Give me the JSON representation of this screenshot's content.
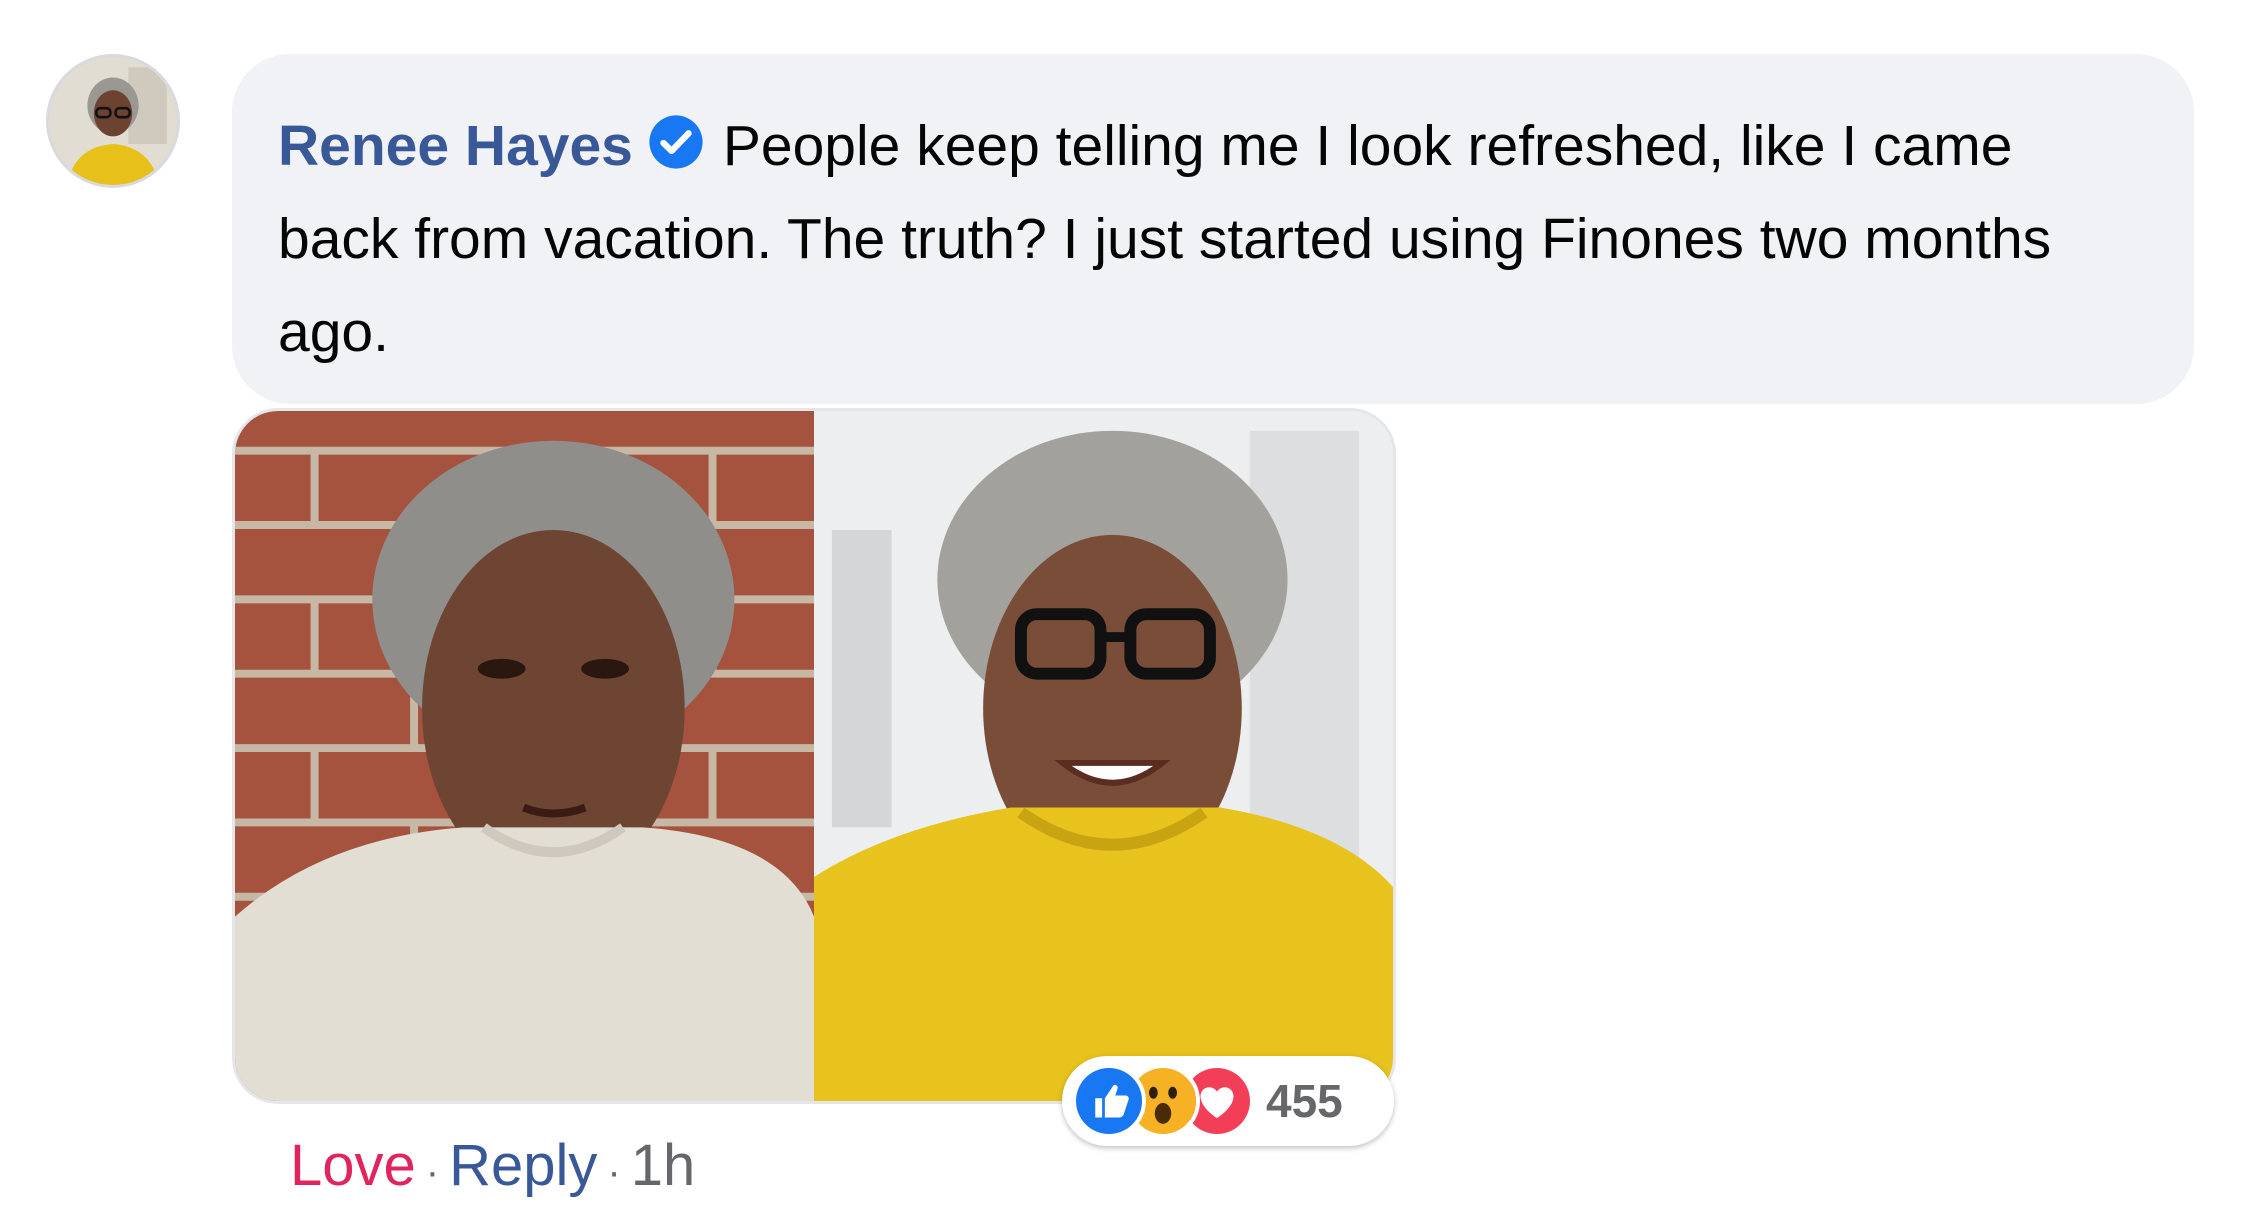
{
  "comment": {
    "author": "Renee Hayes",
    "text": "People keep telling me I look refreshed, like I came back from vacation. The truth? I just started using Finones two months ago.",
    "verified": true
  },
  "avatar": {
    "icon": "profile-photo"
  },
  "photo": {
    "left_icon": "before-photo",
    "right_icon": "after-photo"
  },
  "reactions": {
    "icons": [
      "like-icon",
      "wow-icon",
      "love-icon"
    ],
    "count": "455"
  },
  "actions": {
    "love_label": "Love",
    "reply_label": "Reply",
    "separator": "·",
    "time": "1h"
  },
  "colors": {
    "author_link": "#385898",
    "love": "#e0245e",
    "bubble_bg": "#f0f2f5",
    "meta": "#65676b"
  }
}
